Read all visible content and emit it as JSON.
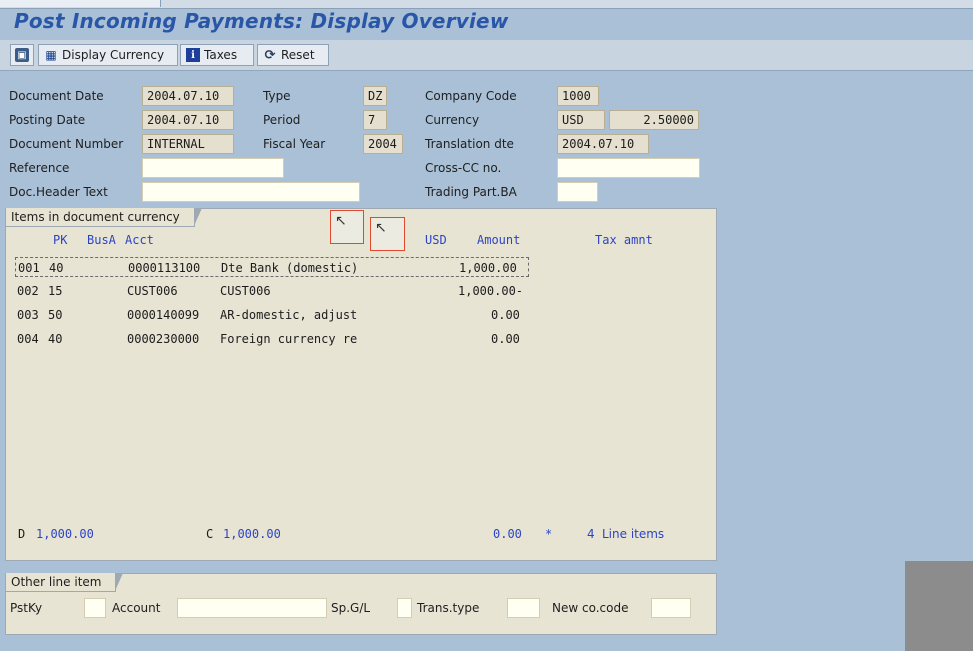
{
  "title": "Post Incoming Payments: Display Overview",
  "toolbar": {
    "display_currency": "Display Currency",
    "taxes": "Taxes",
    "reset": "Reset"
  },
  "header": {
    "document_date_label": "Document Date",
    "document_date": "2004.07.10",
    "posting_date_label": "Posting Date",
    "posting_date": "2004.07.10",
    "document_number_label": "Document Number",
    "document_number": "INTERNAL",
    "reference_label": "Reference",
    "reference": "",
    "doc_header_text_label": "Doc.Header Text",
    "doc_header_text": "",
    "type_label": "Type",
    "type": "DZ",
    "period_label": "Period",
    "period": "7",
    "fiscal_year_label": "Fiscal Year",
    "fiscal_year": "2004",
    "company_code_label": "Company Code",
    "company_code": "1000",
    "currency_label": "Currency",
    "currency": "USD",
    "exchange_rate": "2.50000",
    "translation_dte_label": "Translation dte",
    "translation_dte": "2004.07.10",
    "cross_cc_label": "Cross-CC no.",
    "cross_cc": "",
    "trading_part_label": "Trading Part.BA",
    "trading_part": ""
  },
  "items": {
    "tab_label": "Items in document currency",
    "columns": {
      "pk": "PK",
      "busa": "BusA",
      "acct": "Acct",
      "usd": "USD",
      "amount": "Amount",
      "tax_amnt": "Tax amnt"
    },
    "rows": [
      {
        "no": "001",
        "pk": "40",
        "acct": "0000113100",
        "desc": "Dte Bank (domestic)",
        "amount": "1,000.00"
      },
      {
        "no": "002",
        "pk": "15",
        "acct": "CUST006",
        "desc": "CUST006",
        "amount": "1,000.00-"
      },
      {
        "no": "003",
        "pk": "50",
        "acct": "0000140099",
        "desc": "AR-domestic, adjust",
        "amount": "0.00"
      },
      {
        "no": "004",
        "pk": "40",
        "acct": "0000230000",
        "desc": "Foreign currency re",
        "amount": "0.00"
      }
    ],
    "footer": {
      "d_label": "D",
      "d_value": "1,000.00",
      "c_label": "C",
      "c_value": "1,000.00",
      "balance": "0.00",
      "star": "*",
      "line_items_count": "4",
      "line_items_label": "Line items"
    }
  },
  "other": {
    "tab_label": "Other line item",
    "pstky_label": "PstKy",
    "pstky": "",
    "account_label": "Account",
    "account": "",
    "spgl_label": "Sp.G/L",
    "spgl": "",
    "trans_type_label": "Trans.type",
    "trans_type": "",
    "new_co_code_label": "New co.code",
    "new_co_code": ""
  }
}
